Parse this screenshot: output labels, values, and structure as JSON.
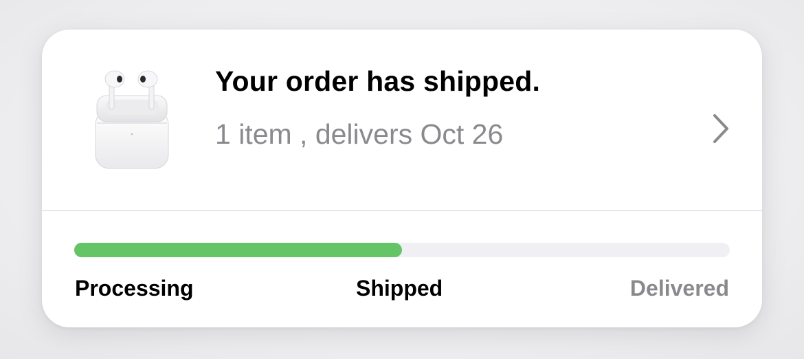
{
  "order": {
    "title": "Your order has shipped.",
    "subtitle": "1 item , delivers Oct 26",
    "product_icon": "airpods-icon",
    "chevron_icon": "chevron-right-icon"
  },
  "progress": {
    "fraction": 0.5,
    "color": "#64c466",
    "track_color": "#f0eff4",
    "steps": [
      {
        "label": "Processing",
        "state": "complete"
      },
      {
        "label": "Shipped",
        "state": "current"
      },
      {
        "label": "Delivered",
        "state": "pending"
      }
    ]
  },
  "colors": {
    "primary_text": "#000000",
    "secondary_text": "#8a8a8e",
    "card_background": "#ffffff"
  }
}
